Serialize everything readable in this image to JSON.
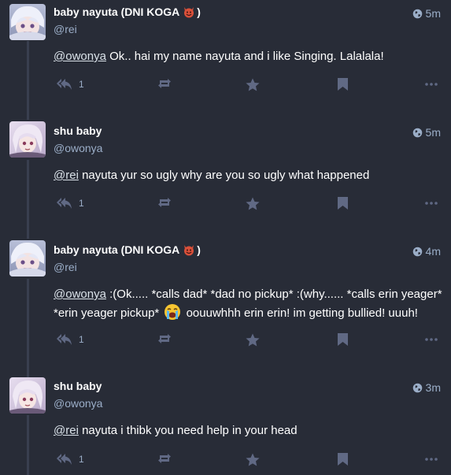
{
  "statuses": [
    {
      "display_name": "baby nayuta (DNI KOGA",
      "display_name_suffix": ")",
      "display_name_emoji": "smiling-devil-emoji",
      "handle": "@rei",
      "time": "5m",
      "mention": "@owonya",
      "text": "Ok.. hai my name nayuta and i like Singing. Lalalala!",
      "reply_count": "1",
      "avatar": "nayuta-avatar"
    },
    {
      "display_name": "shu baby",
      "handle": "@owonya",
      "time": "5m",
      "mention": "@rei",
      "text": "nayuta yur so ugly why are you so ugly what happened",
      "reply_count": "1",
      "avatar": "shu-avatar"
    },
    {
      "display_name": "baby nayuta (DNI KOGA",
      "display_name_suffix": ")",
      "display_name_emoji": "smiling-devil-emoji",
      "handle": "@rei",
      "time": "4m",
      "mention": "@owonya",
      "text_part1": ":(Ok..... *calls dad* *dad no pickup* :(why...... *calls erin yeager* *erin yeager pickup*",
      "text_emoji": "loudly-crying-emoji",
      "text_part2": "oouuwhhh erin erin! im getting bullied! uuuh!",
      "reply_count": "1",
      "avatar": "nayuta-avatar"
    },
    {
      "display_name": "shu baby",
      "handle": "@owonya",
      "time": "3m",
      "mention": "@rei",
      "text": "nayuta i thibk you need help in your head",
      "reply_count": "1",
      "avatar": "shu-avatar"
    }
  ],
  "colors": {
    "background": "#282c37",
    "secondary_text": "#9baec8",
    "action_icon": "#606984",
    "thread_line": "#393f4f"
  },
  "icons": [
    "reply-all-icon",
    "boost-icon",
    "star-icon",
    "bookmark-icon",
    "more-icon",
    "globe-icon"
  ]
}
